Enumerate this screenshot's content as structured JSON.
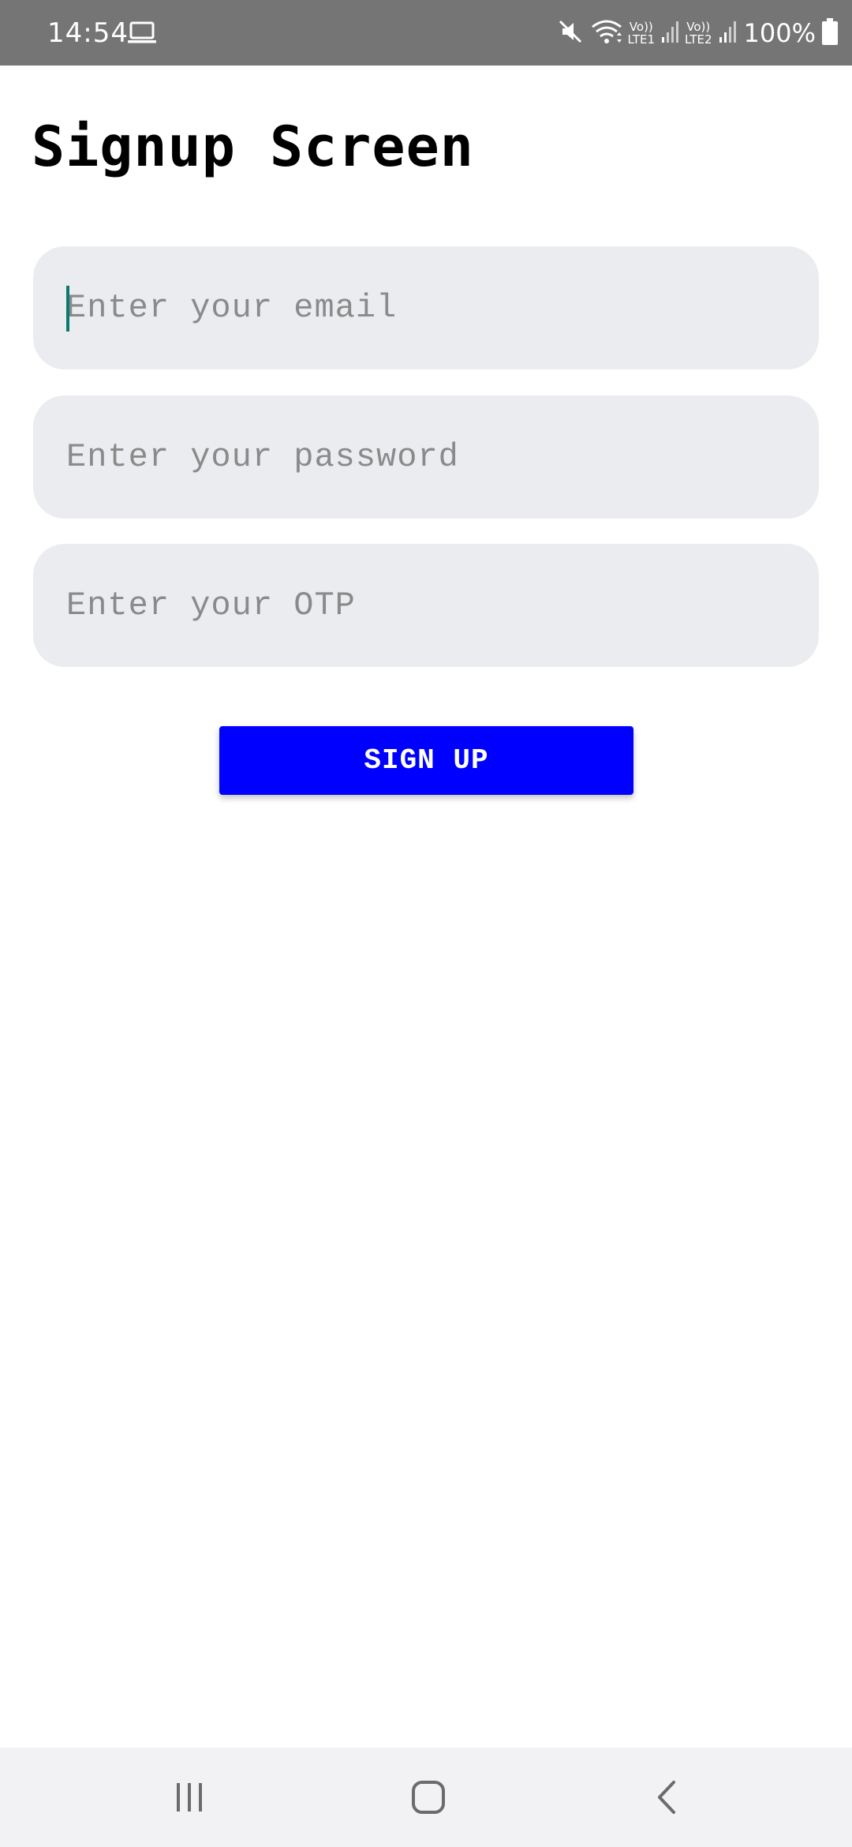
{
  "status_bar": {
    "time": "14:54",
    "sim1_label_top": "Vo))",
    "sim1_label_bottom": "LTE1",
    "sim2_label_top": "Vo))",
    "sim2_label_bottom": "LTE2",
    "battery_percent": "100%",
    "icons": [
      "laptop-icon",
      "mute-icon",
      "wifi-icon",
      "signal-icon",
      "signal-icon",
      "battery-icon"
    ]
  },
  "page": {
    "title": "Signup Screen"
  },
  "form": {
    "email": {
      "placeholder": "Enter your email",
      "value": "",
      "focused": true
    },
    "password": {
      "placeholder": "Enter your password",
      "value": ""
    },
    "otp": {
      "placeholder": "Enter your OTP",
      "value": ""
    },
    "submit_label": "SIGN UP"
  },
  "colors": {
    "status_bar": "#757575",
    "field_background": "#ebecf0",
    "button": "#0000ff",
    "caret": "#0a7a70"
  },
  "nav_bar": {
    "icons": [
      "recents-icon",
      "home-icon",
      "back-icon"
    ]
  }
}
